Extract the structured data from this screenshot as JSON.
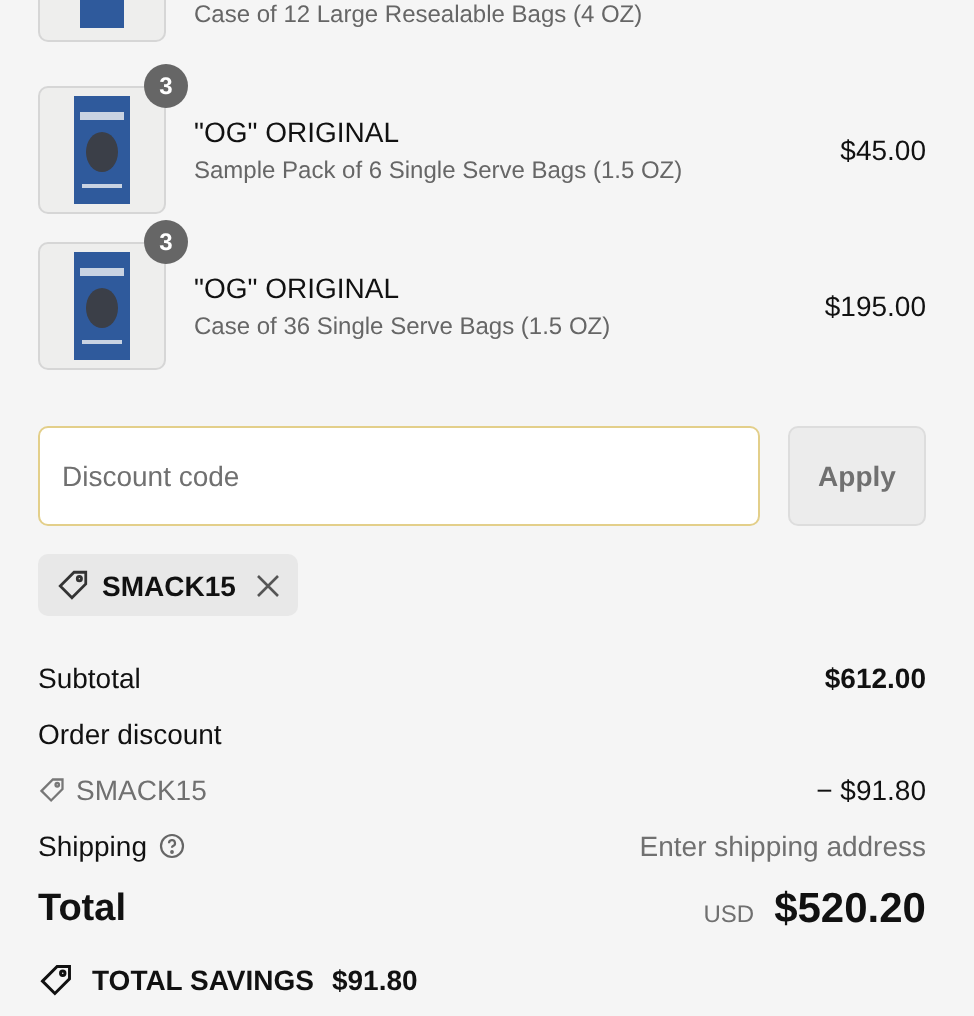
{
  "partial_item": {
    "subtitle": "Case of 12 Large Resealable Bags (4 OZ)"
  },
  "items": [
    {
      "quantity": "3",
      "title": "\"OG\" ORIGINAL",
      "subtitle": "Sample Pack of 6 Single Serve Bags (1.5 OZ)",
      "price": "$45.00"
    },
    {
      "quantity": "3",
      "title": "\"OG\" ORIGINAL",
      "subtitle": "Case of 36 Single Serve Bags (1.5 OZ)",
      "price": "$195.00"
    }
  ],
  "discount": {
    "placeholder": "Discount code",
    "button": "Apply",
    "applied_code": "SMACK15"
  },
  "summary": [
    {
      "kind": "subtotal",
      "label": "Subtotal",
      "value": "$612.00"
    },
    {
      "kind": "heading",
      "label": "Order discount"
    },
    {
      "kind": "code",
      "label": "SMACK15",
      "value": "− $91.80"
    },
    {
      "kind": "shipping",
      "label": "Shipping",
      "value": "Enter shipping address"
    }
  ],
  "total": {
    "label": "Total",
    "currency": "USD",
    "value": "$520.20"
  },
  "savings": {
    "label": "TOTAL SAVINGS",
    "value": "$91.80"
  }
}
